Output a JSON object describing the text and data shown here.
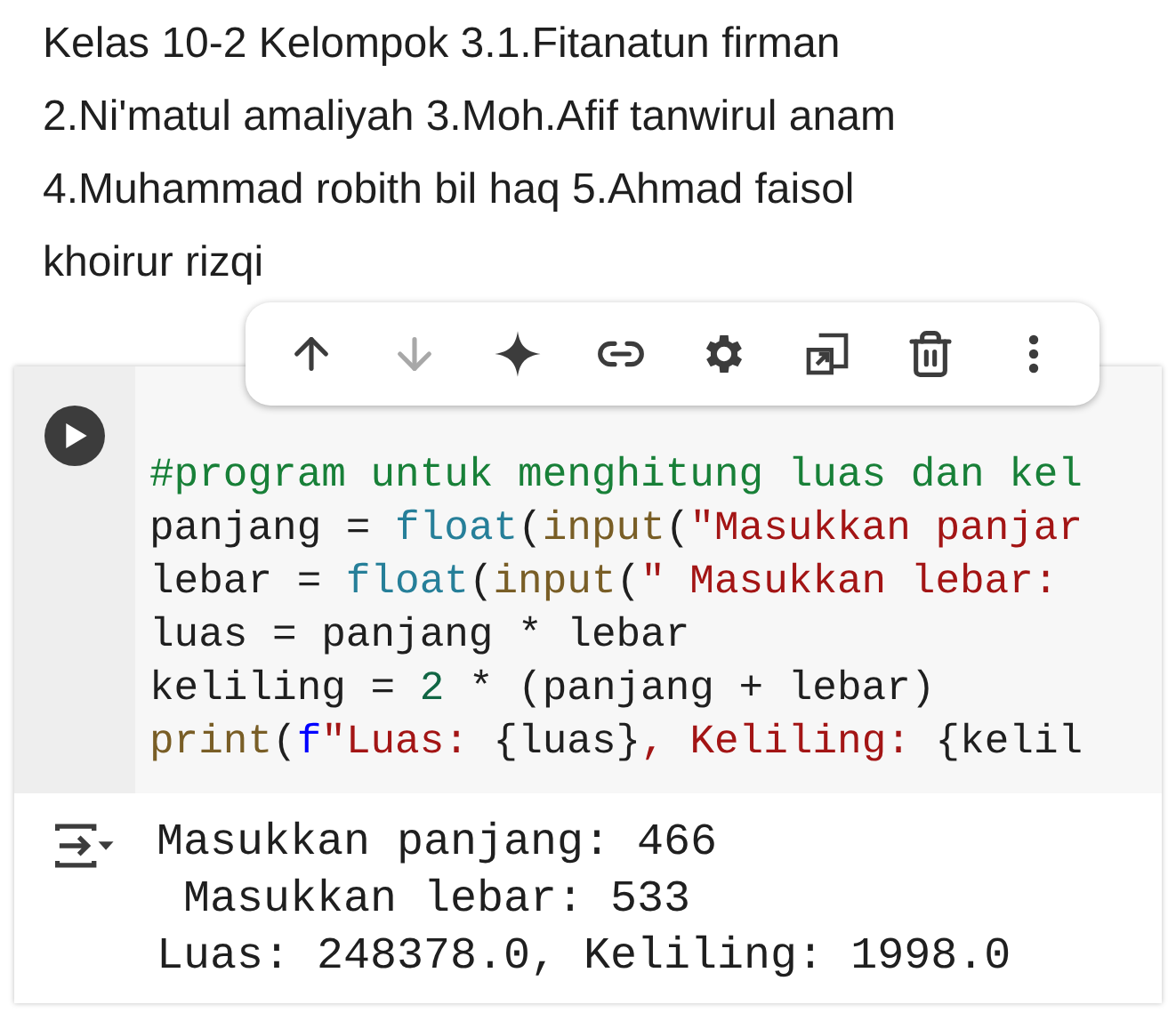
{
  "text_cell": {
    "lines": [
      "Kelas 10-2 Kelompok 3.1.Fitanatun firman",
      "2.Ni'matul amaliyah 3.Moh.Afif tanwirul anam",
      "4.Muhammad robith bil haq 5.Ahmad faisol",
      "khoirur rizqi"
    ]
  },
  "toolbar": [
    {
      "kind": "up",
      "disabled": false
    },
    {
      "kind": "down",
      "disabled": true
    },
    {
      "kind": "sparkle",
      "disabled": false
    },
    {
      "kind": "link",
      "disabled": false
    },
    {
      "kind": "settings",
      "disabled": false
    },
    {
      "kind": "mirror",
      "disabled": false
    },
    {
      "kind": "delete",
      "disabled": false
    },
    {
      "kind": "more",
      "disabled": false
    }
  ],
  "code_cell": {
    "code_lines": [
      [
        {
          "kind": "comment",
          "text": "#program untuk menghitung luas dan kel"
        }
      ],
      [
        {
          "kind": "plain",
          "text": "panjang = "
        },
        {
          "kind": "builtin",
          "text": "float"
        },
        {
          "kind": "plain",
          "text": "("
        },
        {
          "kind": "function",
          "text": "input"
        },
        {
          "kind": "plain",
          "text": "("
        },
        {
          "kind": "string",
          "text": "\"Masukkan panjar"
        }
      ],
      [
        {
          "kind": "plain",
          "text": "lebar = "
        },
        {
          "kind": "builtin",
          "text": "float"
        },
        {
          "kind": "plain",
          "text": "("
        },
        {
          "kind": "function",
          "text": "input"
        },
        {
          "kind": "plain",
          "text": "("
        },
        {
          "kind": "string",
          "text": "\" Masukkan lebar:"
        }
      ],
      [
        {
          "kind": "plain",
          "text": "luas = panjang * lebar"
        }
      ],
      [
        {
          "kind": "plain",
          "text": "keliling = "
        },
        {
          "kind": "number",
          "text": "2"
        },
        {
          "kind": "plain",
          "text": " * (panjang + lebar)"
        }
      ],
      [
        {
          "kind": "function",
          "text": "print"
        },
        {
          "kind": "plain",
          "text": "("
        },
        {
          "kind": "keyword",
          "text": "f"
        },
        {
          "kind": "string",
          "text": "\"Luas: "
        },
        {
          "kind": "plain",
          "text": "{luas}"
        },
        {
          "kind": "string",
          "text": ", Keliling: "
        },
        {
          "kind": "plain",
          "text": "{kelil"
        }
      ]
    ],
    "output_lines": [
      "Masukkan panjang: 466",
      " Masukkan lebar: 533",
      "Luas: 248378.0, Keliling: 1998.0"
    ]
  }
}
